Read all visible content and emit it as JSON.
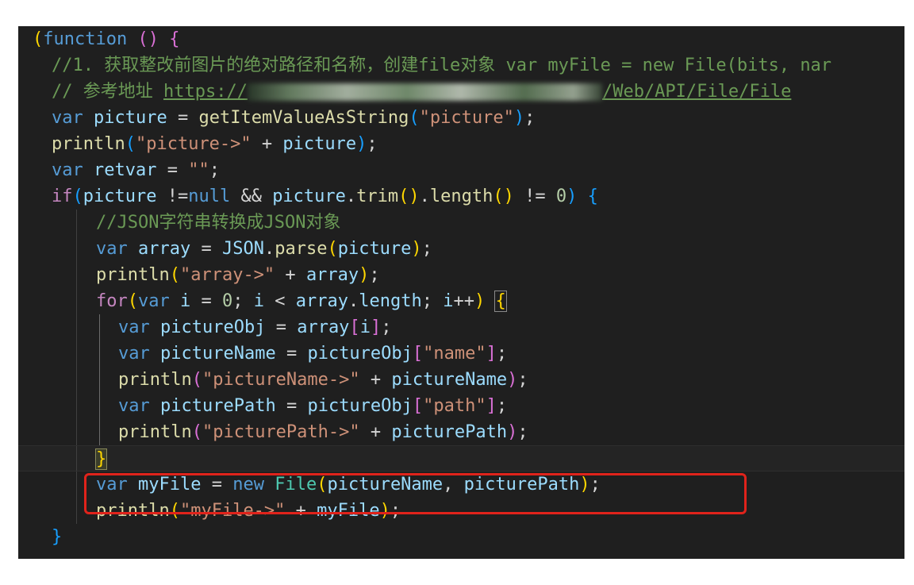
{
  "editor": {
    "lines": [
      {
        "tokens": [
          {
            "c": "p1",
            "t": "("
          },
          {
            "c": "kw",
            "t": "function"
          },
          {
            "c": "",
            "t": " "
          },
          {
            "c": "p2",
            "t": "()"
          },
          {
            "c": "",
            "t": " "
          },
          {
            "c": "p2",
            "t": "{"
          }
        ]
      },
      {
        "tokens": [
          {
            "c": "cmt",
            "t": "//1. 获取整改前图片的绝对路径和名称，创建file对象 var myFile = new File(bits, nar"
          }
        ]
      },
      {
        "tokens": [
          {
            "c": "cmt",
            "t": "// 参考地址 "
          },
          {
            "c": "cmt url",
            "t": "https://"
          },
          {
            "c": "blur",
            "t": ""
          },
          {
            "c": "cmt url",
            "t": "/Web/API/File/File"
          }
        ]
      },
      {
        "tokens": [
          {
            "c": "kw",
            "t": "var"
          },
          {
            "c": "",
            "t": " "
          },
          {
            "c": "var",
            "t": "picture"
          },
          {
            "c": "",
            "t": " = "
          },
          {
            "c": "fn",
            "t": "getItemValueAsString"
          },
          {
            "c": "p3",
            "t": "("
          },
          {
            "c": "str",
            "t": "\"picture\""
          },
          {
            "c": "p3",
            "t": ")"
          },
          {
            "c": "",
            "t": ";"
          }
        ]
      },
      {
        "tokens": [
          {
            "c": "fn",
            "t": "println"
          },
          {
            "c": "p3",
            "t": "("
          },
          {
            "c": "str",
            "t": "\"picture->\""
          },
          {
            "c": "",
            "t": " + "
          },
          {
            "c": "var",
            "t": "picture"
          },
          {
            "c": "p3",
            "t": ")"
          },
          {
            "c": "",
            "t": ";"
          }
        ]
      },
      {
        "tokens": [
          {
            "c": "kw",
            "t": "var"
          },
          {
            "c": "",
            "t": " "
          },
          {
            "c": "var",
            "t": "retvar"
          },
          {
            "c": "",
            "t": " = "
          },
          {
            "c": "str",
            "t": "\"\""
          },
          {
            "c": "",
            "t": ";"
          }
        ]
      },
      {
        "tokens": [
          {
            "c": "ctl",
            "t": "if"
          },
          {
            "c": "p3",
            "t": "("
          },
          {
            "c": "var",
            "t": "picture"
          },
          {
            "c": "",
            "t": " !="
          },
          {
            "c": "kw",
            "t": "null"
          },
          {
            "c": "",
            "t": " && "
          },
          {
            "c": "var",
            "t": "picture"
          },
          {
            "c": "",
            "t": "."
          },
          {
            "c": "fn",
            "t": "trim"
          },
          {
            "c": "p1",
            "t": "()"
          },
          {
            "c": "",
            "t": "."
          },
          {
            "c": "fn",
            "t": "length"
          },
          {
            "c": "p1",
            "t": "()"
          },
          {
            "c": "",
            "t": " != "
          },
          {
            "c": "num",
            "t": "0"
          },
          {
            "c": "p3",
            "t": ")"
          },
          {
            "c": "",
            "t": " "
          },
          {
            "c": "p3",
            "t": "{"
          }
        ]
      },
      {
        "tokens": [
          {
            "c": "cmt",
            "t": "//JSON字符串转换成JSON对象"
          }
        ]
      },
      {
        "tokens": [
          {
            "c": "kw",
            "t": "var"
          },
          {
            "c": "",
            "t": " "
          },
          {
            "c": "var",
            "t": "array"
          },
          {
            "c": "",
            "t": " = "
          },
          {
            "c": "var",
            "t": "JSON"
          },
          {
            "c": "",
            "t": "."
          },
          {
            "c": "fn",
            "t": "parse"
          },
          {
            "c": "p1",
            "t": "("
          },
          {
            "c": "var",
            "t": "picture"
          },
          {
            "c": "p1",
            "t": ")"
          },
          {
            "c": "",
            "t": ";"
          }
        ]
      },
      {
        "tokens": [
          {
            "c": "fn",
            "t": "println"
          },
          {
            "c": "p1",
            "t": "("
          },
          {
            "c": "str",
            "t": "\"array->\""
          },
          {
            "c": "",
            "t": " + "
          },
          {
            "c": "var",
            "t": "array"
          },
          {
            "c": "p1",
            "t": ")"
          },
          {
            "c": "",
            "t": ";"
          }
        ]
      },
      {
        "tokens": [
          {
            "c": "ctl",
            "t": "for"
          },
          {
            "c": "p1",
            "t": "("
          },
          {
            "c": "kw",
            "t": "var"
          },
          {
            "c": "",
            "t": " "
          },
          {
            "c": "var",
            "t": "i"
          },
          {
            "c": "",
            "t": " = "
          },
          {
            "c": "num",
            "t": "0"
          },
          {
            "c": "",
            "t": "; "
          },
          {
            "c": "var",
            "t": "i"
          },
          {
            "c": "",
            "t": " < "
          },
          {
            "c": "var",
            "t": "array"
          },
          {
            "c": "",
            "t": "."
          },
          {
            "c": "var",
            "t": "length"
          },
          {
            "c": "",
            "t": "; "
          },
          {
            "c": "var",
            "t": "i"
          },
          {
            "c": "",
            "t": "++"
          },
          {
            "c": "p1",
            "t": ")"
          },
          {
            "c": "",
            "t": " "
          },
          {
            "c": "p1 bracket-hl",
            "t": "{"
          }
        ]
      },
      {
        "tokens": [
          {
            "c": "kw",
            "t": "var"
          },
          {
            "c": "",
            "t": " "
          },
          {
            "c": "var",
            "t": "pictureObj"
          },
          {
            "c": "",
            "t": " = "
          },
          {
            "c": "var",
            "t": "array"
          },
          {
            "c": "p2",
            "t": "["
          },
          {
            "c": "var",
            "t": "i"
          },
          {
            "c": "p2",
            "t": "]"
          },
          {
            "c": "",
            "t": ";"
          }
        ]
      },
      {
        "tokens": [
          {
            "c": "kw",
            "t": "var"
          },
          {
            "c": "",
            "t": " "
          },
          {
            "c": "var",
            "t": "pictureName"
          },
          {
            "c": "",
            "t": " = "
          },
          {
            "c": "var",
            "t": "pictureObj"
          },
          {
            "c": "p2",
            "t": "["
          },
          {
            "c": "str",
            "t": "\"name\""
          },
          {
            "c": "p2",
            "t": "]"
          },
          {
            "c": "",
            "t": ";"
          }
        ]
      },
      {
        "tokens": [
          {
            "c": "fn",
            "t": "println"
          },
          {
            "c": "p2",
            "t": "("
          },
          {
            "c": "str",
            "t": "\"pictureName->\""
          },
          {
            "c": "",
            "t": " + "
          },
          {
            "c": "var",
            "t": "pictureName"
          },
          {
            "c": "p2",
            "t": ")"
          },
          {
            "c": "",
            "t": ";"
          }
        ]
      },
      {
        "tokens": [
          {
            "c": "kw",
            "t": "var"
          },
          {
            "c": "",
            "t": " "
          },
          {
            "c": "var",
            "t": "picturePath"
          },
          {
            "c": "",
            "t": " = "
          },
          {
            "c": "var",
            "t": "pictureObj"
          },
          {
            "c": "p2",
            "t": "["
          },
          {
            "c": "str",
            "t": "\"path\""
          },
          {
            "c": "p2",
            "t": "]"
          },
          {
            "c": "",
            "t": ";"
          }
        ]
      },
      {
        "tokens": [
          {
            "c": "fn",
            "t": "println"
          },
          {
            "c": "p2",
            "t": "("
          },
          {
            "c": "str",
            "t": "\"picturePath->\""
          },
          {
            "c": "",
            "t": " + "
          },
          {
            "c": "var",
            "t": "picturePath"
          },
          {
            "c": "p2",
            "t": ")"
          },
          {
            "c": "",
            "t": ";"
          }
        ]
      },
      {
        "tokens": [
          {
            "c": "p1 cursor-hl",
            "t": "}"
          }
        ]
      },
      {
        "tokens": [
          {
            "c": "kw",
            "t": "var"
          },
          {
            "c": "",
            "t": " "
          },
          {
            "c": "var",
            "t": "myFile"
          },
          {
            "c": "",
            "t": " = "
          },
          {
            "c": "kw",
            "t": "new"
          },
          {
            "c": "",
            "t": " "
          },
          {
            "c": "cls",
            "t": "File"
          },
          {
            "c": "p1",
            "t": "("
          },
          {
            "c": "var",
            "t": "pictureName"
          },
          {
            "c": "",
            "t": ", "
          },
          {
            "c": "var",
            "t": "picturePath"
          },
          {
            "c": "p1",
            "t": ")"
          },
          {
            "c": "",
            "t": ";"
          }
        ]
      },
      {
        "tokens": [
          {
            "c": "fn",
            "t": "println"
          },
          {
            "c": "p1",
            "t": "("
          },
          {
            "c": "str",
            "t": "\"myFile->\""
          },
          {
            "c": "",
            "t": " + "
          },
          {
            "c": "var",
            "t": "myFile"
          },
          {
            "c": "p1",
            "t": ")"
          },
          {
            "c": "",
            "t": ";"
          }
        ]
      },
      {
        "tokens": [
          {
            "c": "p3",
            "t": "}"
          }
        ]
      }
    ]
  },
  "colors": {
    "background": "#1f1f1f",
    "highlight_box": "#e0231b"
  }
}
